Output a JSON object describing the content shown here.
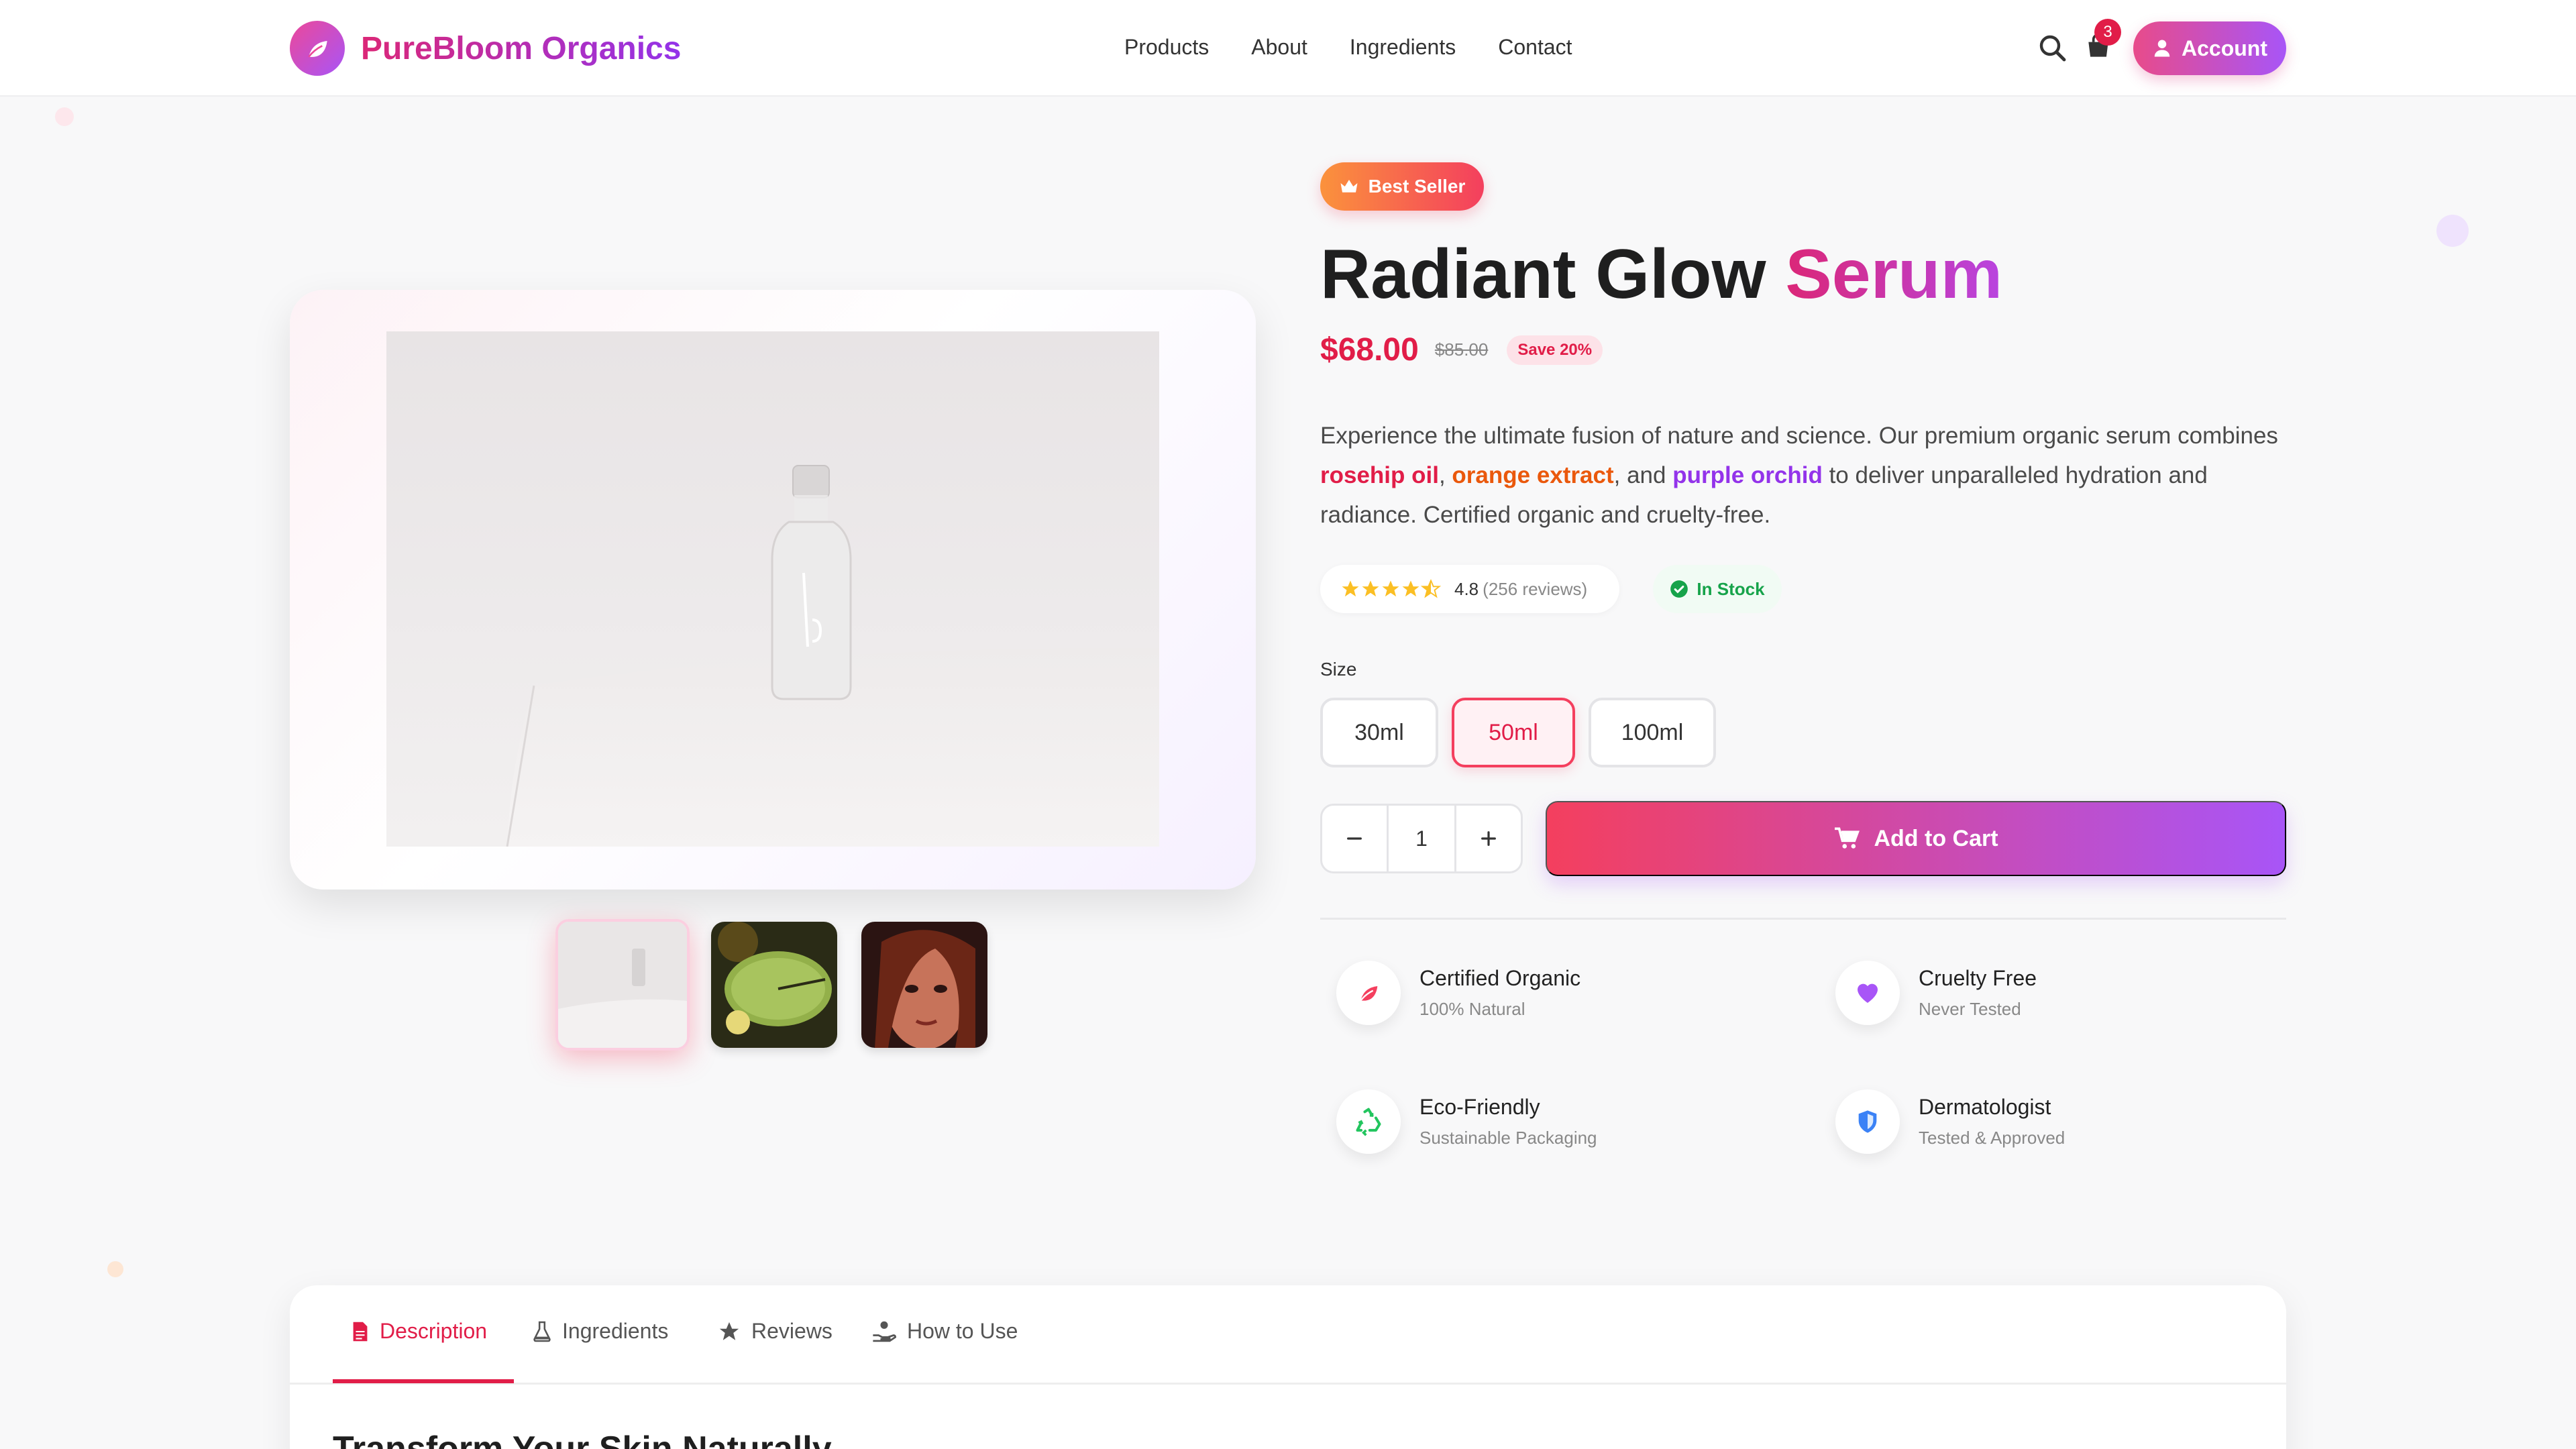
{
  "header": {
    "brand": "PureBloom Organics",
    "nav": [
      "Products",
      "About",
      "Ingredients",
      "Contact"
    ],
    "cart_count": "3",
    "account_label": "Account"
  },
  "gallery": {
    "thumbnails": [
      "serum bottle on white cloth",
      "green lily pad",
      "portrait"
    ]
  },
  "product": {
    "badge": "Best Seller",
    "title_main": "Radiant Glow ",
    "title_accent": "Serum",
    "price": "$68.00",
    "old_price": "$85.00",
    "save": "Save 20%",
    "desc": {
      "p1": "Experience the ultimate fusion of nature and science. Our premium organic serum combines ",
      "ing1": "rosehip oil",
      "sep1": ", ",
      "ing2": "orange extract",
      "sep2": ", and ",
      "ing3": "purple orchid",
      "p2": " to deliver unparalleled hydration and radiance. Certified organic and cruelty-free."
    },
    "rating": "4.8",
    "reviews": "(256 reviews)",
    "stock": "In Stock",
    "size_label": "Size",
    "sizes": [
      "30ml",
      "50ml",
      "100ml"
    ],
    "selected_size": "50ml",
    "quantity": "1",
    "add_to_cart": "Add to Cart"
  },
  "features": [
    {
      "title": "Certified Organic",
      "sub": "100% Natural",
      "icon": "leaf-icon"
    },
    {
      "title": "Cruelty Free",
      "sub": "Never Tested",
      "icon": "heart-icon"
    },
    {
      "title": "Eco-Friendly",
      "sub": "Sustainable Packaging",
      "icon": "recycle-icon"
    },
    {
      "title": "Dermatologist",
      "sub": "Tested & Approved",
      "icon": "shield-icon"
    }
  ],
  "tabs": {
    "items": [
      "Description",
      "Ingredients",
      "Reviews",
      "How to Use"
    ],
    "active": "Description",
    "heading": "Transform Your Skin Naturally"
  },
  "colors": {
    "accent_pink": "#e11d48",
    "accent_purple": "#a855f7",
    "orange": "#ea580c",
    "green": "#16a34a",
    "star": "#fbbf24"
  }
}
